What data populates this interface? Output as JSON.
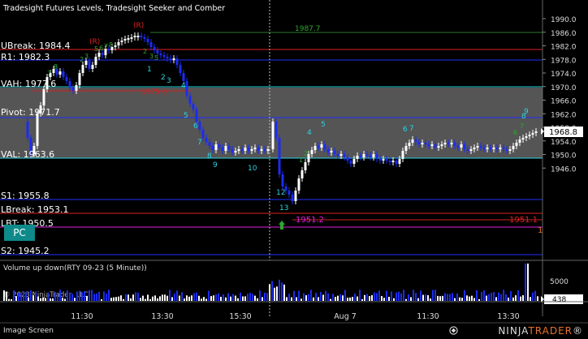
{
  "window": {
    "title": "Tradesight Futures Levels, Tradesight Seeker and Comber",
    "status_label": "Image Screen",
    "brand_main": "NINJA",
    "brand_accent": "TRADER",
    "brand_reg": "®"
  },
  "price_axis": {
    "ticks": [
      "1990.0",
      "1986.0",
      "1982.0",
      "1978.0",
      "1974.0",
      "1970.0",
      "1966.0",
      "1962.0",
      "1958.0",
      "1954.0",
      "1950.0",
      "1946.0"
    ],
    "last_price": "1968.8"
  },
  "time_axis": {
    "ticks": [
      "11:30",
      "13:30",
      "15:30",
      "Aug 7",
      "11:30",
      "13:30",
      "15:30"
    ]
  },
  "levels": {
    "ubreak": "UBreak: 1984.4",
    "r1": "R1: 1982.3",
    "vah": "VAH: 1977.6",
    "pivot": "Pivot: 1971.7",
    "val": "VAL: 1963.6",
    "s1": "S1: 1955.8",
    "lbreak": "LBreak: 1953.1",
    "lbt": "LBT: 1950.5",
    "s2": "S2: 1945.2"
  },
  "annotations": {
    "high_green": "1987.7",
    "red_mid": "1975.6",
    "magenta_low": "1951.2",
    "red_right": "1951.1",
    "red_right_count": "1",
    "reversal_1": "(R)",
    "reversal_2": "(R)",
    "pc_button": "PC"
  },
  "seq_left": [
    "1",
    "2",
    "3",
    "4",
    "5",
    "6",
    "7",
    "8",
    "9",
    "10"
  ],
  "seq_low": [
    "12",
    "13"
  ],
  "seq_right": [
    "4",
    "5",
    "6",
    "7",
    "8",
    "9"
  ],
  "volume_panel": {
    "title": "Volume up down(RTY 09-23 (5 Minute))",
    "copyright": "© 2023 NinjaTrader, LLC",
    "tick_5000": "5000",
    "last_volume": "438"
  },
  "colors": {
    "background": "#000000",
    "up_candle": "#ffffff",
    "down_candle": "#1c2cf0",
    "value_area": "#545454",
    "cyan": "#2ad4e0",
    "green": "#2ea82e",
    "red": "#e01818",
    "magenta": "#e020e0"
  }
}
